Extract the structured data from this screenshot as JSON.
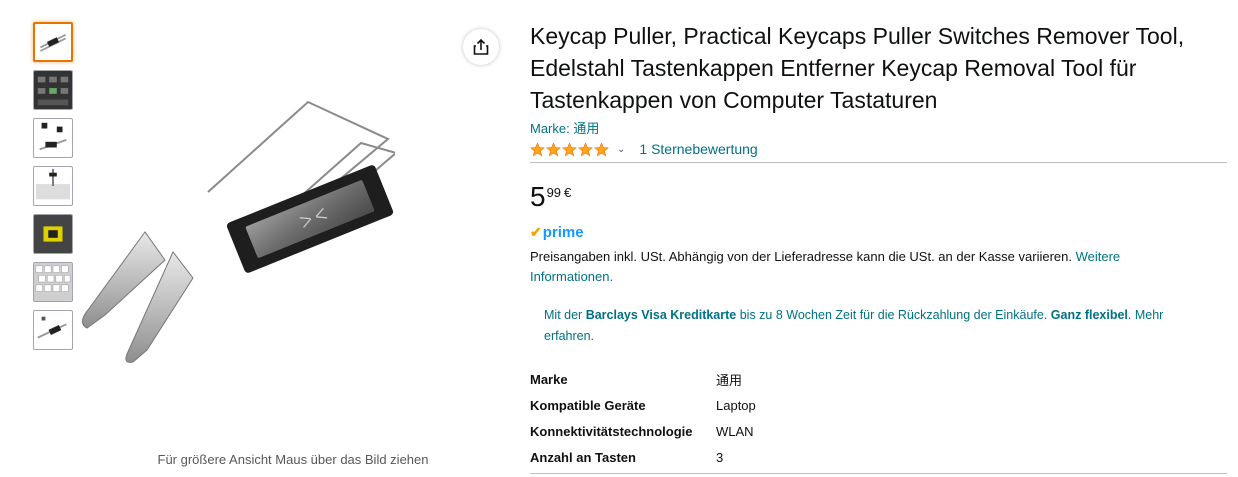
{
  "title": "Keycap Puller, Practical Keycaps Puller Switches Remover Tool, Edelstahl Tastenkappen Entferner Keycap Removal Tool für Tastenkappen von Computer Tastaturen",
  "brand_link": "Marke: 通用",
  "rating": {
    "stars": 5,
    "count_text": "1 Sternebewertung"
  },
  "price": {
    "whole": "5",
    "fraction": "99",
    "currency": "€"
  },
  "prime_label": "prime",
  "vat": {
    "text": "Preisangaben inkl. USt. Abhängig von der Lieferadresse kann die USt. an der Kasse variieren. ",
    "link": "Weitere Informationen."
  },
  "card_offer": {
    "prefix": "Mit der ",
    "card_name": "Barclays Visa Kreditkarte",
    "middle": " bis zu 8 Wochen Zeit für die Rückzahlung der Einkäufe. ",
    "highlight": "Ganz flexibel",
    "suffix": ". Mehr erfahren."
  },
  "specs": [
    {
      "label": "Marke",
      "value": "通用"
    },
    {
      "label": "Kompatible Geräte",
      "value": "Laptop"
    },
    {
      "label": "Konnektivitätstechnologie",
      "value": "WLAN"
    },
    {
      "label": "Anzahl an Tasten",
      "value": "3"
    }
  ],
  "image_hint": "Für größere Ansicht Maus über das Bild ziehen",
  "thumbnail_count": 7,
  "colors": {
    "link": "#007185",
    "prime": "#1399ff",
    "star": "#ffa41c",
    "selected_border": "#e77600"
  },
  "icons": {
    "share": "share-icon",
    "star": "star-icon",
    "chevron": "chevron-down-icon"
  }
}
